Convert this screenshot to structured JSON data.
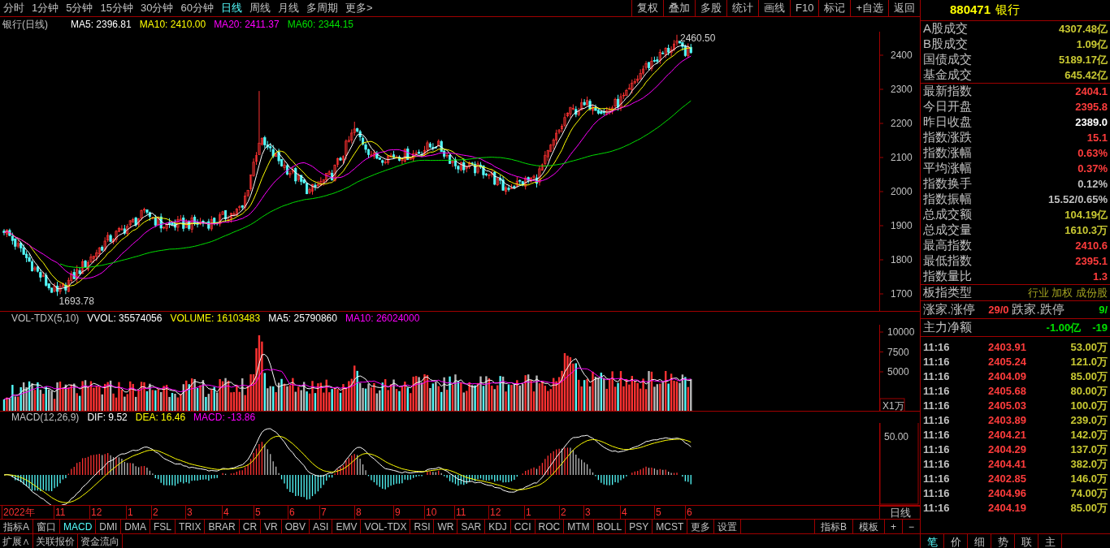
{
  "period_tabs": [
    {
      "label": "分时",
      "selected": false
    },
    {
      "label": "1分钟",
      "selected": false
    },
    {
      "label": "5分钟",
      "selected": false
    },
    {
      "label": "15分钟",
      "selected": false
    },
    {
      "label": "30分钟",
      "selected": false
    },
    {
      "label": "60分钟",
      "selected": false
    },
    {
      "label": "日线",
      "selected": true
    },
    {
      "label": "周线",
      "selected": false
    },
    {
      "label": "月线",
      "selected": false
    },
    {
      "label": "多周期",
      "selected": false
    },
    {
      "label": "更多>",
      "selected": false
    }
  ],
  "toolbar_buttons": [
    "复权",
    "叠加",
    "多股",
    "统计",
    "画线",
    "F10",
    "标记",
    "+自选",
    "返回"
  ],
  "price_chart": {
    "title": "银行(日线)",
    "legend": [
      {
        "text": "MA5: 2396.81",
        "color": "#ffffff"
      },
      {
        "text": "MA10: 2410.00",
        "color": "#ffff00"
      },
      {
        "text": "MA20: 2411.37",
        "color": "#ff00ff"
      },
      {
        "text": "MA60: 2344.15",
        "color": "#00e000"
      }
    ],
    "yticks": [
      "2400",
      "2300",
      "2200",
      "2100",
      "2000",
      "1900",
      "1800",
      "1700"
    ],
    "high_label": "2460.50",
    "low_label": "1693.78"
  },
  "volume_chart": {
    "legend": [
      {
        "text": "VOL-TDX(5,10)",
        "color": "#c0c0c0"
      },
      {
        "text": "VVOL: 35574056",
        "color": "#ffffff"
      },
      {
        "text": "VOLUME: 16103483",
        "color": "#ffff00"
      },
      {
        "text": "MA5: 25790860",
        "color": "#ffffff"
      },
      {
        "text": "MA10: 26024000",
        "color": "#ff00ff"
      }
    ],
    "yticks": [
      "10000",
      "7500",
      "5000"
    ],
    "unit": "X1万"
  },
  "macd_chart": {
    "legend": [
      {
        "text": "MACD(12,26,9)",
        "color": "#c0c0c0"
      },
      {
        "text": "DIF: 9.52",
        "color": "#ffffff"
      },
      {
        "text": "DEA: 16.46",
        "color": "#ffff00"
      },
      {
        "text": "MACD: -13.86",
        "color": "#ff00ff"
      }
    ],
    "yticks": [
      "50.00"
    ]
  },
  "x_axis": {
    "labels": [
      "2022年",
      "11",
      "12",
      "1",
      "2",
      "3",
      "4",
      "5",
      "6",
      "7",
      "8",
      "9",
      "10",
      "11",
      "12",
      "1",
      "2",
      "3",
      "4",
      "5",
      "6"
    ],
    "period": "日线"
  },
  "indicator_tabs": [
    {
      "label": "指标A",
      "selected": false
    },
    {
      "label": "窗口",
      "selected": false
    },
    {
      "label": "MACD",
      "selected": true
    },
    {
      "label": "DMI",
      "selected": false
    },
    {
      "label": "DMA",
      "selected": false
    },
    {
      "label": "FSL",
      "selected": false
    },
    {
      "label": "TRIX",
      "selected": false
    },
    {
      "label": "BRAR",
      "selected": false
    },
    {
      "label": "CR",
      "selected": false
    },
    {
      "label": "VR",
      "selected": false
    },
    {
      "label": "OBV",
      "selected": false
    },
    {
      "label": "ASI",
      "selected": false
    },
    {
      "label": "EMV",
      "selected": false
    },
    {
      "label": "VOL-TDX",
      "selected": false
    },
    {
      "label": "RSI",
      "selected": false
    },
    {
      "label": "WR",
      "selected": false
    },
    {
      "label": "SAR",
      "selected": false
    },
    {
      "label": "KDJ",
      "selected": false
    },
    {
      "label": "CCI",
      "selected": false
    },
    {
      "label": "ROC",
      "selected": false
    },
    {
      "label": "MTM",
      "selected": false
    },
    {
      "label": "BOLL",
      "selected": false
    },
    {
      "label": "PSY",
      "selected": false
    },
    {
      "label": "MCST",
      "selected": false
    },
    {
      "label": "更多",
      "selected": false
    },
    {
      "label": "设置",
      "selected": false
    }
  ],
  "indicator_tabs_right": [
    "指标B",
    "模板",
    "+",
    "−"
  ],
  "bottom_tabs": [
    "扩展∧",
    "关联报价",
    "资金流向"
  ],
  "quote_panel": {
    "code": "880471",
    "name": "银行",
    "turnover": [
      {
        "label": "A股成交",
        "value": "4307.48亿",
        "color": "#c8c832"
      },
      {
        "label": "B股成交",
        "value": "1.09亿",
        "color": "#c8c832"
      },
      {
        "label": "国债成交",
        "value": "5189.17亿",
        "color": "#c8c832"
      },
      {
        "label": "基金成交",
        "value": "645.42亿",
        "color": "#c8c832"
      }
    ],
    "stats": [
      {
        "label": "最新指数",
        "value": "2404.1",
        "color": "#ff3c3c"
      },
      {
        "label": "今日开盘",
        "value": "2395.8",
        "color": "#ff3c3c"
      },
      {
        "label": "昨日收盘",
        "value": "2389.0",
        "color": "#ffffff"
      },
      {
        "label": "指数涨跌",
        "value": "15.1",
        "color": "#ff3c3c"
      },
      {
        "label": "指数涨幅",
        "value": "0.63%",
        "color": "#ff3c3c"
      },
      {
        "label": "平均涨幅",
        "value": "0.37%",
        "color": "#ff3c3c"
      },
      {
        "label": "指数换手",
        "value": "0.12%",
        "color": "#c0c0c0"
      },
      {
        "label": "指数振幅",
        "value": "15.52/0.65%",
        "color": "#c0c0c0"
      },
      {
        "label": "总成交额",
        "value": "104.19亿",
        "color": "#c8c832"
      },
      {
        "label": "总成交量",
        "value": "1610.3万",
        "color": "#c8c832"
      },
      {
        "label": "最高指数",
        "value": "2410.6",
        "color": "#ff3c3c"
      },
      {
        "label": "最低指数",
        "value": "2395.1",
        "color": "#ff3c3c"
      },
      {
        "label": "指数量比",
        "value": "1.3",
        "color": "#ff3c3c"
      }
    ],
    "type": {
      "label": "板指类型",
      "value": "行业 加权 成份股"
    },
    "breadth": {
      "up_label": "涨家.涨停",
      "up_value": "29/0",
      "down_label": "跌家.跌停",
      "down_value": "9/"
    },
    "main_net": {
      "label": "主力净额",
      "value": "-1.00亿",
      "extra": "-19"
    },
    "ticks": [
      {
        "time": "11:16",
        "price": "2403.91",
        "volume": "53.00万"
      },
      {
        "time": "11:16",
        "price": "2405.24",
        "volume": "121.0万"
      },
      {
        "time": "11:16",
        "price": "2404.09",
        "volume": "85.00万"
      },
      {
        "time": "11:16",
        "price": "2405.68",
        "volume": "80.00万"
      },
      {
        "time": "11:16",
        "price": "2405.03",
        "volume": "100.0万"
      },
      {
        "time": "11:16",
        "price": "2403.89",
        "volume": "239.0万"
      },
      {
        "time": "11:16",
        "price": "2404.21",
        "volume": "142.0万"
      },
      {
        "time": "11:16",
        "price": "2404.29",
        "volume": "137.0万"
      },
      {
        "time": "11:16",
        "price": "2404.41",
        "volume": "382.0万"
      },
      {
        "time": "11:16",
        "price": "2402.85",
        "volume": "146.0万"
      },
      {
        "time": "11:16",
        "price": "2404.96",
        "volume": "74.00万"
      },
      {
        "time": "11:16",
        "price": "2404.19",
        "volume": "85.00万"
      }
    ],
    "tabs": [
      {
        "label": "笔",
        "selected": true
      },
      {
        "label": "价",
        "selected": false
      },
      {
        "label": "细",
        "selected": false
      },
      {
        "label": "势",
        "selected": false
      },
      {
        "label": "联",
        "selected": false
      },
      {
        "label": "主",
        "selected": false
      }
    ]
  }
}
